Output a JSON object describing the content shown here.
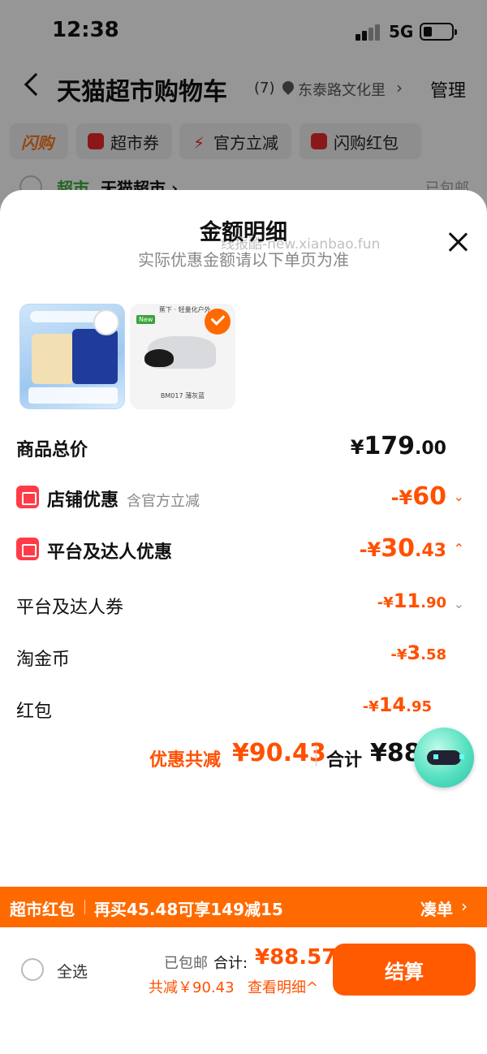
{
  "status_bar": {
    "time": "12:38",
    "network": "5G"
  },
  "nav": {
    "title": "天猫超市购物车",
    "count": "(7)",
    "location": "东泰路文化里",
    "location_arrow": "›",
    "manage": "管理"
  },
  "chips": [
    {
      "label": "闪购"
    },
    {
      "label": "超市券"
    },
    {
      "label": "官方立减"
    },
    {
      "label": "闪购红包"
    }
  ],
  "shop_peek": {
    "tag": "超市",
    "name": "天猫超市 ›",
    "shipping": "已包邮"
  },
  "sheet": {
    "title": "金额明细",
    "subtitle": "实际优惠金额请以下单页为准",
    "watermark": "线报酷-new.xianbao.fun",
    "products": [
      {
        "name": "tempo tissue pack",
        "top_text": "",
        "model": ""
      },
      {
        "name": "mask",
        "top_text": "蕉下 · 轻量化户外",
        "new_tag": "New",
        "model": "BM017 薄灰蓝"
      }
    ],
    "rows": {
      "total": {
        "label": "商品总价",
        "currency": "¥",
        "int": "179",
        "dec": ".00"
      },
      "store": {
        "label": "店铺优惠",
        "note": "含官方立减",
        "prefix": "-¥",
        "int": "60",
        "dec": "",
        "chevron": "⌄"
      },
      "platform": {
        "label": "平台及达人优惠",
        "prefix": "-¥",
        "int": "30",
        "dec": ".43",
        "chevron": "⌃"
      },
      "coupon": {
        "label": "平台及达人券",
        "prefix": "-¥",
        "int": "11",
        "dec": ".90",
        "chevron": "⌄"
      },
      "coins": {
        "label": "淘金币",
        "prefix": "-¥",
        "int": "3",
        "dec": ".58"
      },
      "redpacket": {
        "label": "红包",
        "prefix": "-¥",
        "int": "14",
        "dec": ".95"
      }
    },
    "summary": {
      "saved_label": "优惠共减",
      "saved_amount": "¥90.43",
      "total_label": "合计",
      "total_amount": "¥88"
    }
  },
  "promo": {
    "left": "超市红包",
    "message": "再买45.48可享149减15",
    "action": "凑单",
    "arrow": "›"
  },
  "bottom": {
    "select_all": "全选",
    "shipping": "已包邮",
    "total_label": "合计:",
    "total_amount": "¥88.57",
    "saved": "共减￥90.43",
    "detail": "查看明细^",
    "checkout": "结算"
  },
  "colors": {
    "accent": "#ff5000",
    "promo_bar": "#ff6a00",
    "success": "#3aa339"
  }
}
